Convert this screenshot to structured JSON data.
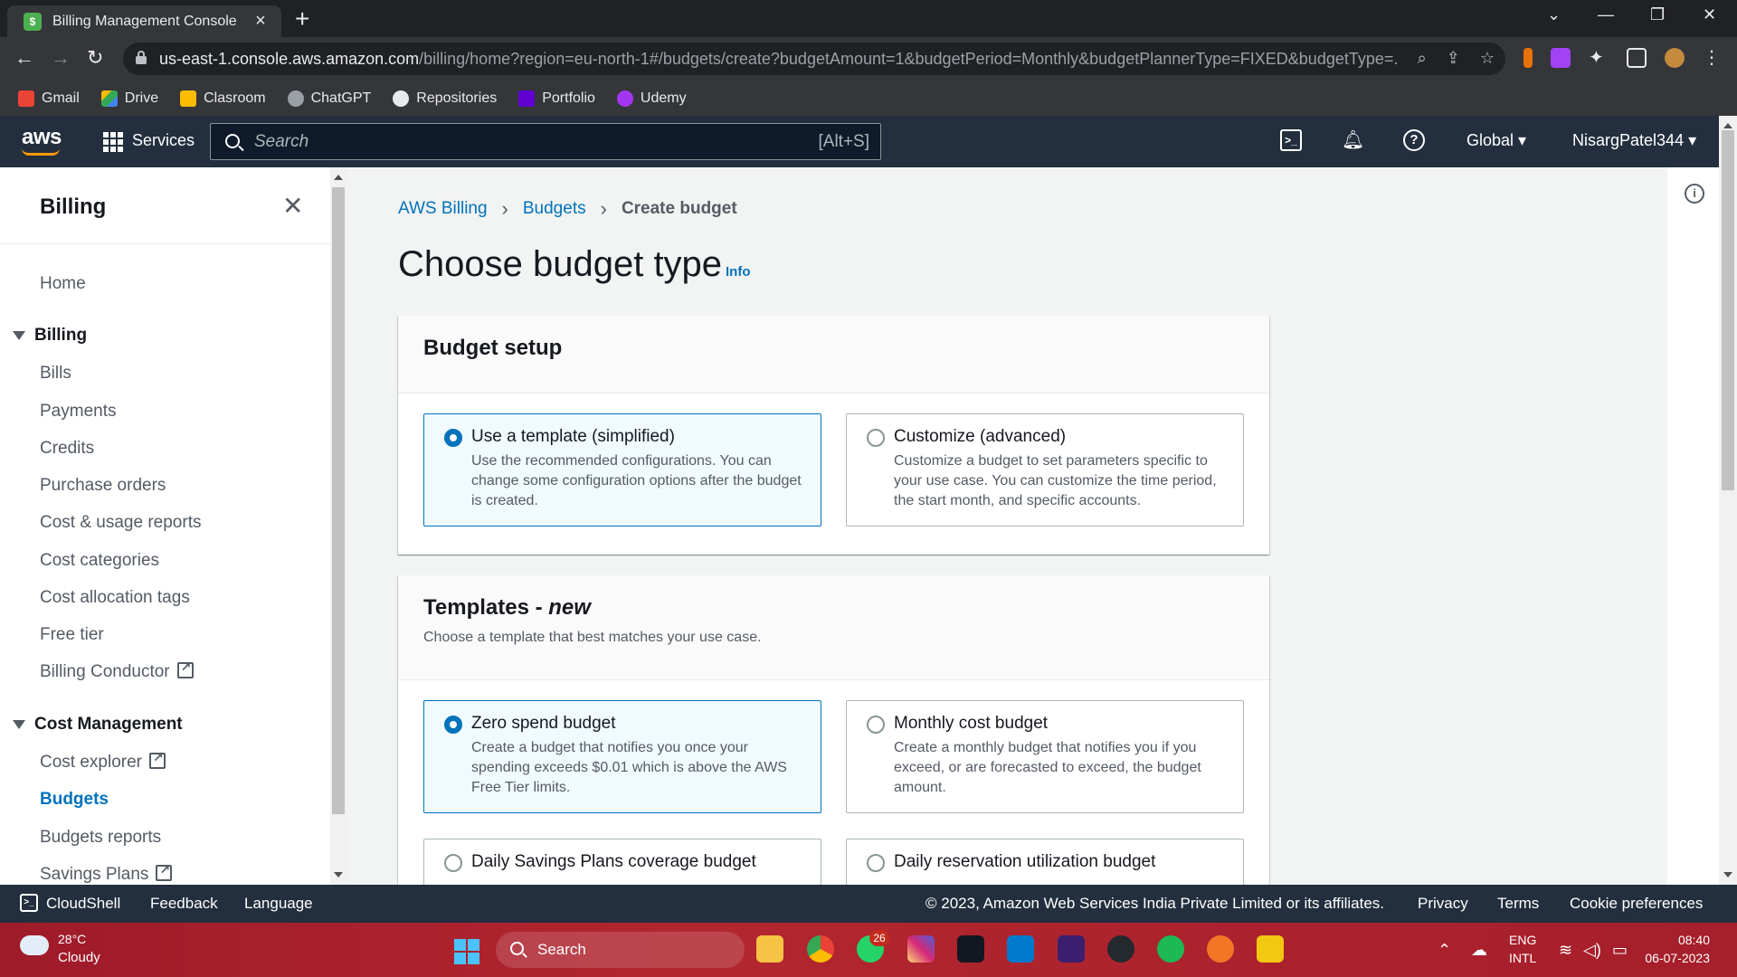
{
  "browser": {
    "tab_title": "Billing Management Console",
    "url_host": "us-east-1.console.aws.amazon.com",
    "url_path": "/billing/home?region=eu-north-1#/budgets/create?budgetAmount=1&budgetPeriod=Monthly&budgetPlannerType=FIXED&budgetType=...",
    "bookmarks": [
      "Gmail",
      "Drive",
      "Clasroom",
      "ChatGPT",
      "Repositories",
      "Portfolio",
      "Udemy"
    ]
  },
  "aws_header": {
    "logo": "aws",
    "services": "Services",
    "search_placeholder": "Search",
    "search_shortcut": "[Alt+S]",
    "region": "Global",
    "account": "NisargPatel344"
  },
  "sidenav": {
    "title": "Billing",
    "home": "Home",
    "billing_section": "Billing",
    "billing_items": [
      "Bills",
      "Payments",
      "Credits",
      "Purchase orders",
      "Cost & usage reports",
      "Cost categories",
      "Cost allocation tags",
      "Free tier",
      "Billing Conductor"
    ],
    "cost_section": "Cost Management",
    "cost_items": [
      "Cost explorer",
      "Budgets",
      "Budgets reports",
      "Savings Plans"
    ]
  },
  "breadcrumb": {
    "items": [
      "AWS Billing",
      "Budgets",
      "Create budget"
    ]
  },
  "page": {
    "title": "Choose budget type",
    "info": "Info"
  },
  "budget_setup": {
    "title": "Budget setup",
    "options": [
      {
        "label": "Use a template (simplified)",
        "desc": "Use the recommended configurations. You can change some configuration options after the budget is created.",
        "selected": true
      },
      {
        "label": "Customize (advanced)",
        "desc": "Customize a budget to set parameters specific to your use case. You can customize the time period, the start month, and specific accounts.",
        "selected": false
      }
    ]
  },
  "templates": {
    "title": "Templates - ",
    "title_em": "new",
    "desc": "Choose a template that best matches your use case.",
    "options": [
      {
        "label": "Zero spend budget",
        "desc": "Create a budget that notifies you once your spending exceeds $0.01 which is above the AWS Free Tier limits.",
        "selected": true
      },
      {
        "label": "Monthly cost budget",
        "desc": "Create a monthly budget that notifies you if you exceed, or are forecasted to exceed, the budget amount.",
        "selected": false
      },
      {
        "label": "Daily Savings Plans coverage budget",
        "desc": "",
        "selected": false
      },
      {
        "label": "Daily reservation utilization budget",
        "desc": "",
        "selected": false
      }
    ]
  },
  "footer": {
    "cloudshell": "CloudShell",
    "feedback": "Feedback",
    "language": "Language",
    "copyright": "© 2023, Amazon Web Services India Private Limited or its affiliates.",
    "privacy": "Privacy",
    "terms": "Terms",
    "cookies": "Cookie preferences"
  },
  "taskbar": {
    "temp": "28°C",
    "weather": "Cloudy",
    "search": "Search",
    "whatsapp_badge": "26",
    "lang1": "ENG",
    "lang2": "INTL",
    "time": "08:40",
    "date": "06-07-2023"
  },
  "colors": {
    "aws_header": "#232f3e",
    "aws_orange": "#ff9900",
    "link_blue": "#0073bb",
    "selected_tile_bg": "#f1faff"
  }
}
